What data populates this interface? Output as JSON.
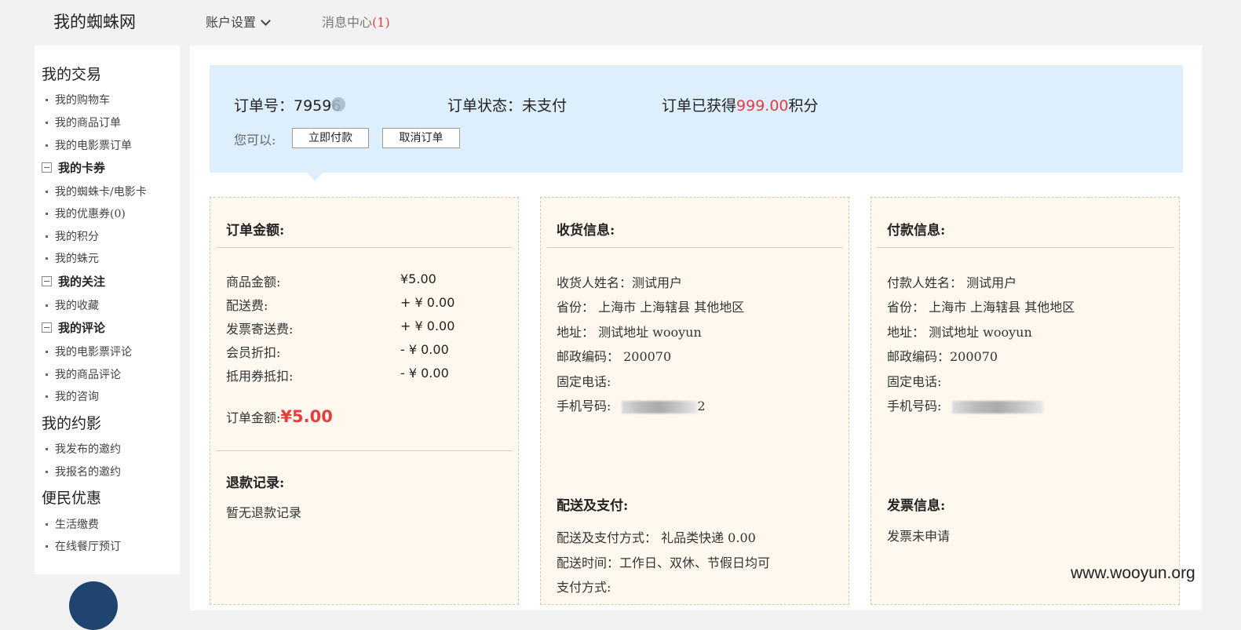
{
  "header": {
    "site_title": "我的蜘蛛网",
    "nav_account": "账户设置",
    "nav_messages": "消息中心",
    "nav_messages_count": "(1)"
  },
  "sidebar": {
    "groups": [
      {
        "title": "我的交易"
      },
      {
        "title": "我的约影"
      },
      {
        "title": "便民优惠"
      }
    ],
    "items": [
      "我的购物车",
      "我的商品订单",
      "我的电影票订单",
      "我的蜘蛛卡/电影卡",
      "我的优惠券(0)",
      "我的积分",
      "我的蛛元",
      "我的收藏",
      "我的电影票评论",
      "我的商品评论",
      "我的咨询",
      "我发布的邀约",
      "我报名的邀约",
      "生活缴费",
      "在线餐厅预订"
    ],
    "subs": [
      "我的卡券",
      "我的关注",
      "我的评论"
    ]
  },
  "order": {
    "number_label": "订单号：79596",
    "status_label": "订单状态：未支付",
    "points_prefix": "订单已获得",
    "points_value": "999.00",
    "points_suffix": "积分",
    "can_label": "您可以:",
    "pay_button": "立即付款",
    "cancel_button": "取消订单"
  },
  "amount_panel": {
    "title": "订单金额:",
    "rows": [
      {
        "label": "商品金额:",
        "value": "¥5.00"
      },
      {
        "label": "配送费:",
        "value": "+ ¥ 0.00"
      },
      {
        "label": "发票寄送费:",
        "value": "+ ¥ 0.00"
      },
      {
        "label": "会员折扣:",
        "value": "- ¥ 0.00"
      },
      {
        "label": "抵用券抵扣:",
        "value": "- ¥ 0.00"
      }
    ],
    "total_label": "订单金额:",
    "total_value": "¥5.00",
    "refund_title": "退款记录:",
    "refund_text": "暂无退款记录"
  },
  "shipping_panel": {
    "title": "收货信息:",
    "lines": [
      "收货人姓名：测试用户",
      "省份：  上海市 上海辖县 其他地区",
      "地址：  测试地址 wooyun",
      "邮政编码：  200070",
      "固定电话:"
    ],
    "mobile_label": "手机号码:",
    "mobile_tail": "2",
    "delivery_title": "配送及支付:",
    "delivery_lines": [
      "配送及支付方式：  礼品类快递 0.00",
      "配送时间：工作日、双休、节假日均可",
      "支付方式:"
    ]
  },
  "payment_panel": {
    "title": "付款信息:",
    "lines": [
      "付款人姓名：  测试用户",
      "省份：  上海市 上海辖县 其他地区",
      "地址：  测试地址 wooyun",
      "邮政编码：200070",
      "固定电话:"
    ],
    "mobile_label": "手机号码:",
    "invoice_title": "发票信息:",
    "invoice_text": "发票未申请"
  },
  "watermark": "www.wooyun.org",
  "colors": {
    "accent_red": "#e43f3f",
    "order_head_bg": "#ddeefc",
    "panel_bg": "#fef8ee"
  }
}
